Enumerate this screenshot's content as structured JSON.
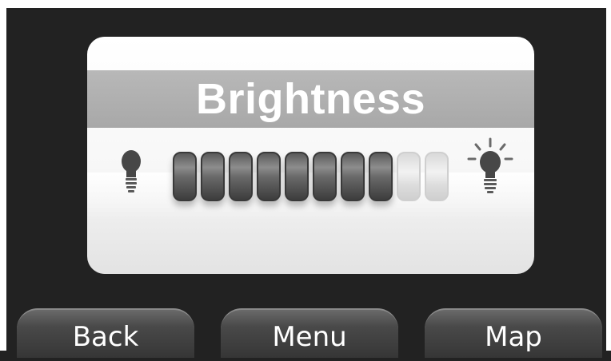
{
  "dialog": {
    "title": "Brightness",
    "brightness": {
      "level": 8,
      "max": 10
    }
  },
  "softkeys": {
    "back_label": "Back",
    "menu_label": "Menu",
    "map_label": "Map"
  },
  "icons": {
    "dim": "lightbulb-off-icon",
    "bright": "lightbulb-on-icon"
  },
  "colors": {
    "background": "#222222",
    "panel": "#f5f5f5",
    "title_band": "#aaaaaa",
    "segment_on": "#555555",
    "segment_off": "#e0e0e0"
  }
}
